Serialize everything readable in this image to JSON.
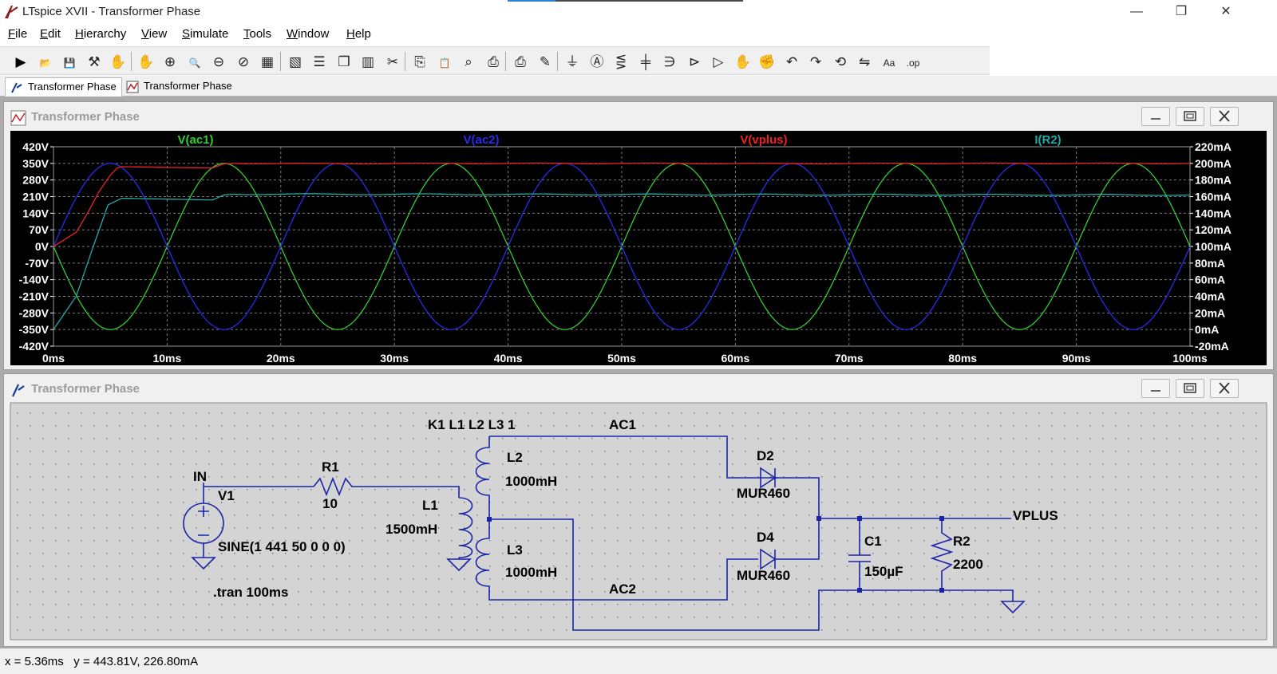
{
  "window": {
    "title": "LTspice XVII - Transformer Phase",
    "minimize": "—",
    "restore": "❐",
    "close": "✕"
  },
  "menu": [
    "File",
    "Edit",
    "Hierarchy",
    "View",
    "Simulate",
    "Tools",
    "Window",
    "Help"
  ],
  "toolbar_icons": [
    "run-icon",
    "open-icon",
    "save-icon",
    "control-panel-icon",
    "halt-icon",
    "pan-icon",
    "zoom-in-icon",
    "zoom-area-icon",
    "zoom-out-icon",
    "zoom-cancel-icon",
    "autorange-icon",
    "view-dc-icon",
    "tile-horizontal-icon",
    "cascade-icon",
    "tile-vertical-icon",
    "cut-icon",
    "copy-icon",
    "paste-icon",
    "find-icon",
    "print-setup-icon",
    "print-icon",
    "wire-icon",
    "ground-icon",
    "label-icon",
    "resistor-icon",
    "capacitor-icon",
    "inductor-icon",
    "diode-icon",
    "component-icon",
    "move-icon",
    "drag-icon",
    "undo-icon",
    "redo-icon",
    "rotate-icon",
    "mirror-icon",
    "text-icon",
    "spice-directive-icon"
  ],
  "tabs": [
    {
      "label": "Transformer Phase",
      "kind": "schematic"
    },
    {
      "label": "Transformer Phase",
      "kind": "waveform"
    }
  ],
  "plot_window": {
    "title": "Transformer Phase"
  },
  "schematic_window": {
    "title": "Transformer Phase"
  },
  "chart_data": {
    "type": "line",
    "x_unit": "ms",
    "xlim": [
      0,
      100
    ],
    "x_ticks": [
      "0ms",
      "10ms",
      "20ms",
      "30ms",
      "40ms",
      "50ms",
      "60ms",
      "70ms",
      "80ms",
      "90ms",
      "100ms"
    ],
    "left_axis": {
      "ylim": [
        -420,
        420
      ],
      "ticks": [
        "420V",
        "350V",
        "280V",
        "210V",
        "140V",
        "70V",
        "0V",
        "-70V",
        "-140V",
        "-210V",
        "-280V",
        "-350V",
        "-420V"
      ]
    },
    "right_axis": {
      "ylim": [
        -20,
        220
      ],
      "ticks": [
        "220mA",
        "200mA",
        "180mA",
        "160mA",
        "140mA",
        "120mA",
        "100mA",
        "80mA",
        "60mA",
        "40mA",
        "20mA",
        "0mA",
        "-20mA"
      ]
    },
    "grid": true,
    "background": "#000000",
    "series": [
      {
        "name": "V(ac1)",
        "color": "#33cc33",
        "axis": "left",
        "kind": "sine",
        "amplitude": 350,
        "frequency_hz": 50,
        "phase_deg": 180
      },
      {
        "name": "V(ac2)",
        "color": "#2a2aee",
        "axis": "left",
        "kind": "sine",
        "amplitude": 350,
        "frequency_hz": 50,
        "phase_deg": 0
      },
      {
        "name": "V(vplus)",
        "color": "#ee2222",
        "axis": "left",
        "kind": "rectified",
        "points": [
          [
            0,
            0
          ],
          [
            2,
            60
          ],
          [
            3,
            140
          ],
          [
            4,
            230
          ],
          [
            5,
            300
          ],
          [
            5.6,
            330
          ],
          [
            6,
            336
          ],
          [
            8,
            335
          ],
          [
            10,
            333
          ],
          [
            12,
            332
          ],
          [
            14,
            331
          ],
          [
            15,
            348
          ],
          [
            16,
            350
          ],
          [
            25,
            349
          ],
          [
            35,
            350
          ],
          [
            45,
            350
          ],
          [
            55,
            350
          ],
          [
            65,
            349
          ],
          [
            75,
            350
          ],
          [
            85,
            350
          ],
          [
            95,
            350
          ],
          [
            100,
            350
          ]
        ]
      },
      {
        "name": "I(R2)",
        "color": "#22aaaa",
        "axis": "right",
        "kind": "current",
        "points": [
          [
            0,
            0
          ],
          [
            2,
            40
          ],
          [
            3.5,
            100
          ],
          [
            4.8,
            150
          ],
          [
            6,
            158
          ],
          [
            10,
            157
          ],
          [
            14,
            156
          ],
          [
            15,
            162
          ],
          [
            16,
            163
          ],
          [
            100,
            162
          ]
        ]
      }
    ]
  },
  "schematic": {
    "labels": {
      "in": "IN",
      "v1": "V1",
      "v1_value": "SINE(1 441 50 0 0 0)",
      "r1": "R1",
      "r1_value": "10",
      "l1": "L1",
      "l1_value": "1500mH",
      "k1": "K1 L1 L2 L3 1",
      "l2": "L2",
      "l2_value": "1000mH",
      "l3": "L3",
      "l3_value": "1000mH",
      "ac1": "AC1",
      "ac2": "AC2",
      "d2": "D2",
      "d2_value": "MUR460",
      "d4": "D4",
      "d4_value": "MUR460",
      "c1": "C1",
      "c1_value": "150µF",
      "r2": "R2",
      "r2_value": "2200",
      "vplus": "VPLUS",
      "tran": ".tran 100ms"
    }
  },
  "status": {
    "text": "x = 5.36ms   y = 443.81V, 226.80mA"
  }
}
